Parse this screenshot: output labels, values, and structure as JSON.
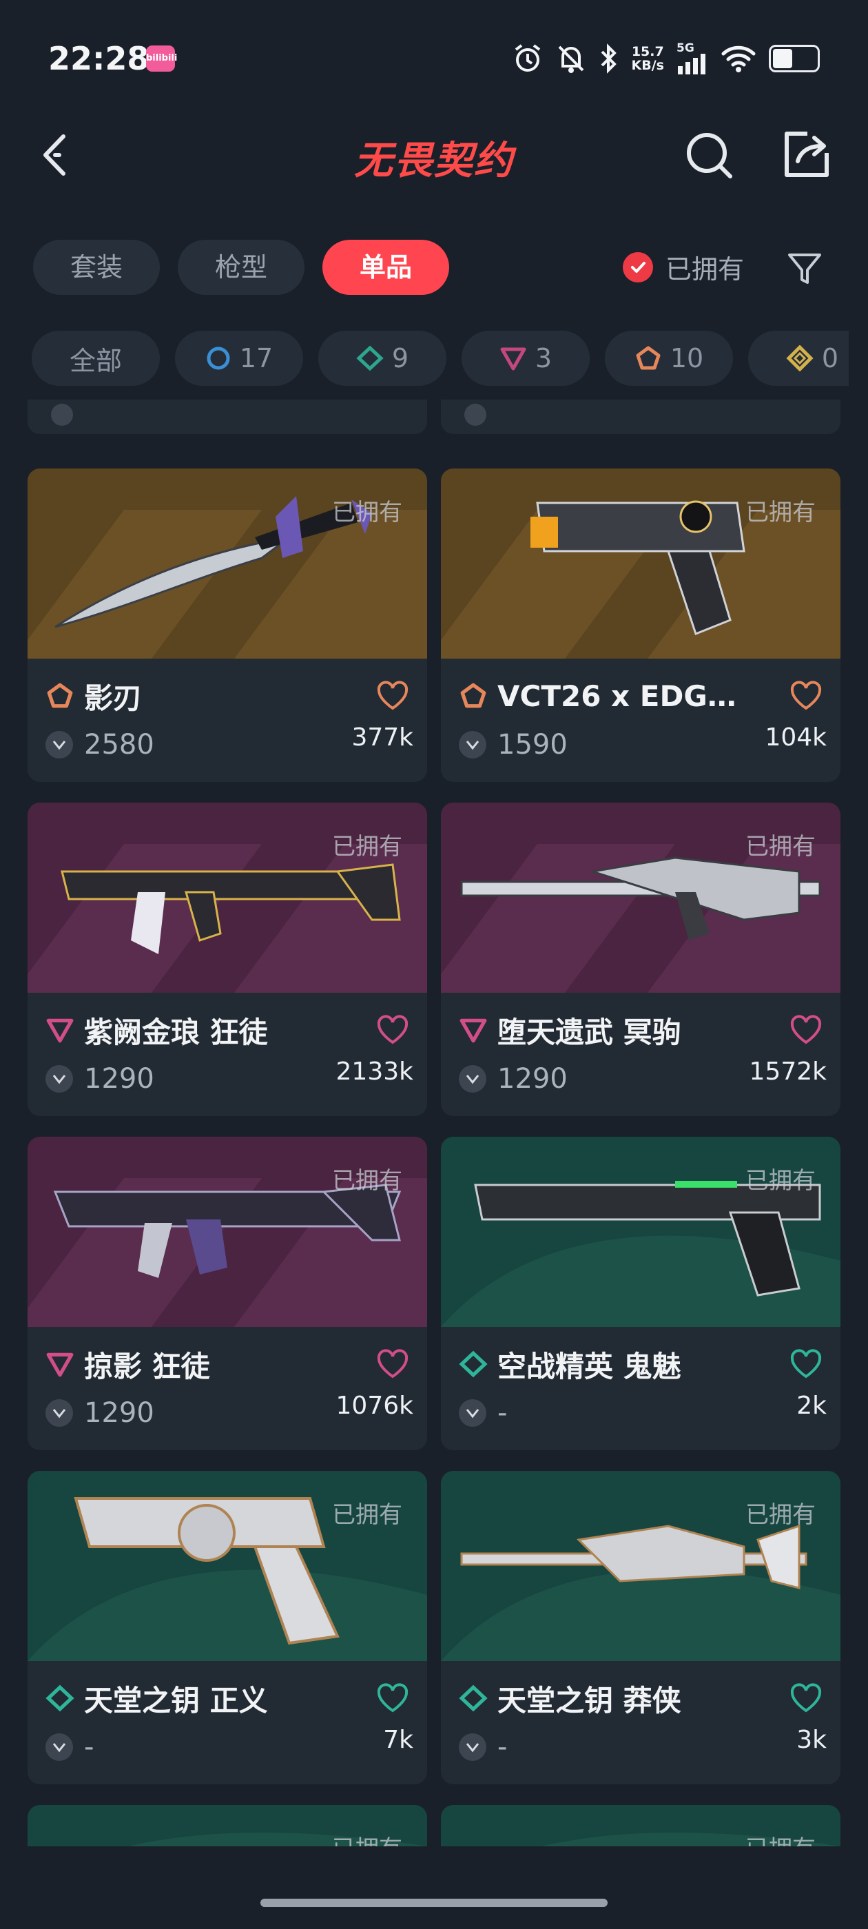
{
  "status_bar": {
    "time": "22:28",
    "app_icon_text": "bilibili",
    "net_speed_top": "15.7",
    "net_speed_bottom": "KB/s",
    "signal_label": "5G"
  },
  "header": {
    "title": "无畏契约",
    "title_color": "#ff4a4a"
  },
  "tabs": [
    {
      "label": "套装",
      "active": false
    },
    {
      "label": "枪型",
      "active": false
    },
    {
      "label": "单品",
      "active": true
    }
  ],
  "owned_filter": {
    "label": "已拥有",
    "checked": true
  },
  "rarity_chips": [
    {
      "label": "全部",
      "icon": null
    },
    {
      "label": "17",
      "icon": "select-edition-icon",
      "color": "#3b8fd4"
    },
    {
      "label": "9",
      "icon": "deluxe-edition-icon",
      "color": "#2ea68d"
    },
    {
      "label": "3",
      "icon": "premium-edition-icon",
      "color": "#c4487d"
    },
    {
      "label": "10",
      "icon": "exclusive-edition-icon",
      "color": "#e6875b"
    },
    {
      "label": "0",
      "icon": "ultra-edition-icon",
      "color": "#d3b14c"
    }
  ],
  "items": [
    {
      "name": "影刃",
      "price": "2580",
      "likes": "377k",
      "owned": "已拥有",
      "rarity": "exclusive",
      "rarity_color": "#e6875b",
      "bg": "#5b4420",
      "weapon": "knife"
    },
    {
      "name": "VCT26 x EDG…",
      "price": "1590",
      "likes": "104k",
      "owned": "已拥有",
      "rarity": "exclusive",
      "rarity_color": "#e6875b",
      "bg": "#5b4420",
      "weapon": "pistol"
    },
    {
      "name": "紫阙金琅 狂徒",
      "price": "1290",
      "likes": "2133k",
      "owned": "已拥有",
      "rarity": "premium",
      "rarity_color": "#d24e88",
      "bg": "#4a2440",
      "weapon": "rifle"
    },
    {
      "name": "堕天遗武 冥驹",
      "price": "1290",
      "likes": "1572k",
      "owned": "已拥有",
      "rarity": "premium",
      "rarity_color": "#d24e88",
      "bg": "#4a2440",
      "weapon": "sniper"
    },
    {
      "name": "掠影 狂徒",
      "price": "1290",
      "likes": "1076k",
      "owned": "已拥有",
      "rarity": "premium",
      "rarity_color": "#d24e88",
      "bg": "#4a2440",
      "weapon": "rifle2"
    },
    {
      "name": "空战精英 鬼魅",
      "price": "-",
      "likes": "2k",
      "owned": "已拥有",
      "rarity": "deluxe",
      "rarity_color": "#2fb59a",
      "bg": "#17453f",
      "weapon": "pistol2"
    },
    {
      "name": "天堂之钥 正义",
      "price": "-",
      "likes": "7k",
      "owned": "已拥有",
      "rarity": "deluxe",
      "rarity_color": "#2fb59a",
      "bg": "#17453f",
      "weapon": "revolver"
    },
    {
      "name": "天堂之钥 莽侠",
      "price": "-",
      "likes": "3k",
      "owned": "已拥有",
      "rarity": "deluxe",
      "rarity_color": "#2fb59a",
      "bg": "#17453f",
      "weapon": "sniper2"
    }
  ],
  "partial_bottom": [
    {
      "owned": "已拥有"
    },
    {
      "owned": "已拥有"
    }
  ]
}
